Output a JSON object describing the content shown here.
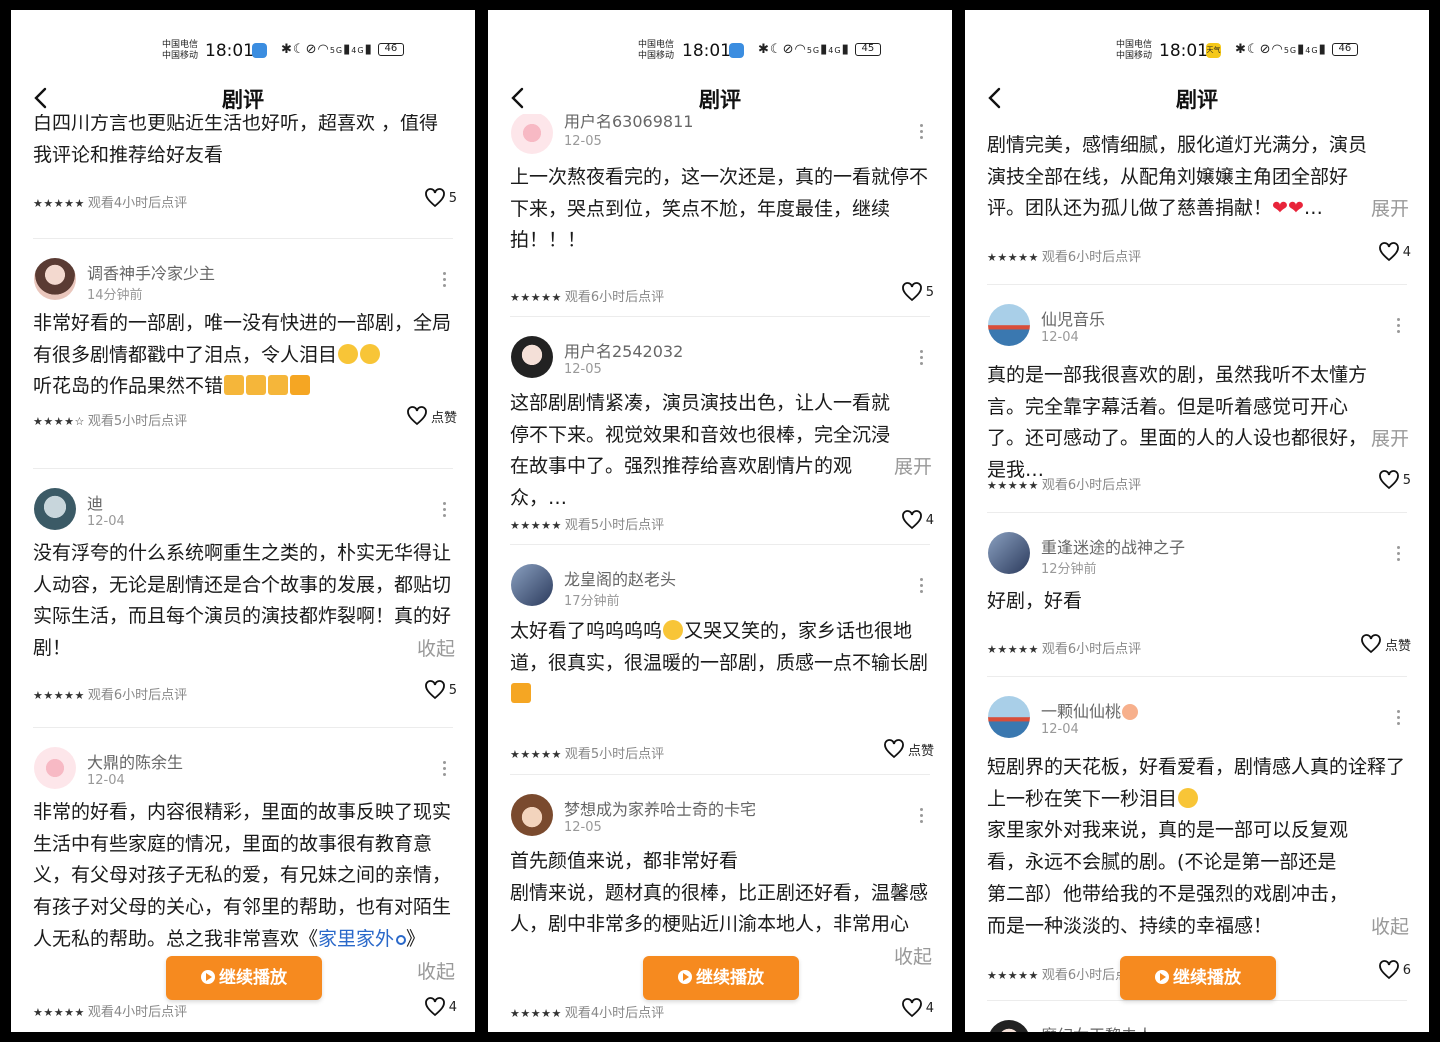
{
  "status": {
    "carrier_line1": "中国电信",
    "carrier_line2": "中国移动",
    "time": "18:01",
    "signal": "5G",
    "signal2": "4G",
    "screens": [
      {
        "battery": "46",
        "weather": ""
      },
      {
        "battery": "45",
        "weather": ""
      },
      {
        "battery": "46",
        "weather": "天气"
      }
    ]
  },
  "header": {
    "title": "剧评"
  },
  "play_button_label": "继续播放",
  "screens": [
    {
      "reviews": [
        {
          "text_partial": "白四川方言也更贴近生活也好听，超喜欢 ，值得我评论和推荐给好友看",
          "meta": "观看4小时后点评",
          "likes": "5"
        },
        {
          "username": "调香神手冷家少主",
          "time": "14分钟前",
          "text": "非常好看的一部剧，唯一没有快进的一部剧，全局有很多剧情都戳中了泪点，令人泪目",
          "text2": "听花岛的作品果然不错",
          "meta": "观看5小时后点评",
          "likes": "点赞",
          "stars": 4.5
        },
        {
          "username": "迪",
          "time": "12-04",
          "text": "没有浮夸的什么系统啊重生之类的，朴实无华得让人动容，无论是剧情还是合个故事的发展，都贴切实际生活，而且每个演员的演技都炸裂啊！真的好剧！",
          "toggle": "收起",
          "meta": "观看6小时后点评",
          "likes": "5"
        },
        {
          "username": "大鼎的陈余生",
          "time": "12-04",
          "text": "非常的好看，内容很精彩，里面的故事反映了现实生活中有些家庭的情况，里面的故事很有教育意义，有父母对孩子无私的爱，有兄妹之间的亲情，有孩子对父母的关心，有邻里的帮助，也有对陌生人无私的帮助。总之我非常喜欢《",
          "link": "家里家外",
          "text_end": "》",
          "toggle": "收起",
          "meta": "观看4小时后点评",
          "likes": "4"
        }
      ]
    },
    {
      "reviews": [
        {
          "username": "用户名63069811",
          "time": "12-05",
          "text": "上一次熬夜看完的，这一次还是，真的一看就停不下来，哭点到位，笑点不尬，年度最佳，继续拍！！！",
          "meta": "观看6小时后点评",
          "likes": "5"
        },
        {
          "username": "用户名2542032",
          "time": "12-05",
          "text": "这部剧剧情紧凑，演员演技出色，让人一看就停不下来。视觉效果和音效也很棒，完全沉浸在故事中了。强烈推荐给喜欢剧情片的观众，…",
          "toggle": "展开",
          "meta": "观看5小时后点评",
          "likes": "4"
        },
        {
          "username": "龙皇阁的赵老头",
          "time": "17分钟前",
          "text": "太好看了呜呜呜呜",
          "text2": "又哭又笑的，家乡话也很地道，很真实，很温暖的一部剧，质感一点不输长剧",
          "meta": "观看5小时后点评",
          "likes": "点赞"
        },
        {
          "username": "梦想成为家养哈士奇的卡宅",
          "time": "12-05",
          "text": "首先颜值来说，都非常好看",
          "text2": "剧情来说，题材真的很棒，比正剧还好看，温馨感人，剧中非常多的梗贴近川渝本地人，非常用心",
          "toggle": "收起",
          "meta": "观看4小时后点评",
          "likes": "4"
        }
      ]
    },
    {
      "reviews": [
        {
          "text_partial": "剧情完美，感情细腻，服化道灯光满分，演员演技全部在线，从配角刘嬢嬢主角团全部好评。团队还为孤儿做了慈善捐献！",
          "text_tail": "…",
          "toggle": "展开",
          "meta": "观看6小时后点评",
          "likes": "4"
        },
        {
          "username": "仙児音乐",
          "time": "12-04",
          "text": "真的是一部我很喜欢的剧，虽然我听不太懂方言。完全靠字幕活着。但是听着感觉可开心了。还可感动了。里面的人的人设也都很好，是我…",
          "toggle": "展开",
          "meta": "观看6小时后点评",
          "likes": "5"
        },
        {
          "username": "重逢迷途的战神之子",
          "time": "12分钟前",
          "text": "好剧，好看",
          "meta": "观看6小时后点评",
          "likes": "点赞"
        },
        {
          "username": "一颗仙仙桃",
          "time": "12-04",
          "text": "短剧界的天花板，好看爱看，剧情感人真的诠释了上一秒在笑下一秒泪目",
          "text2": "家里家外对我来说，真的是一部可以反复观看，永远不会腻的剧。(不论是第一部还是第二部）他带给我的不是强烈的戏剧冲击，而是一种淡淡的、持续的幸福感！",
          "toggle": "收起",
          "meta": "观看6小时后点评",
          "likes": "6"
        },
        {
          "username": "魔幻女王黎夫人"
        }
      ]
    }
  ],
  "colors": {
    "accent": "#f68a1f",
    "link": "#2a68c9",
    "text": "#1a1a1a",
    "muted": "#999999"
  }
}
